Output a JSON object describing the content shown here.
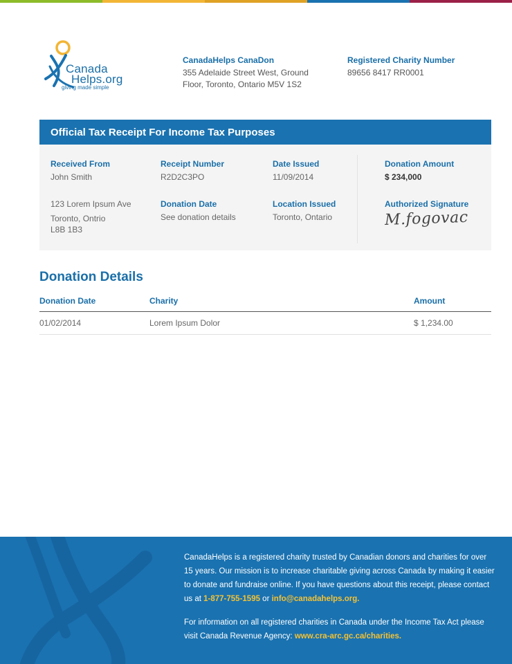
{
  "colors": {
    "primary": "#1a72b0",
    "accent": "#f5c233",
    "topbar": [
      "#8dbb2a",
      "#f2b535",
      "#e0a225",
      "#1a72b0",
      "#9b2148"
    ]
  },
  "logo": {
    "word1": "Canada",
    "word2": "Helps.org",
    "tagline": "giving made simple"
  },
  "header": {
    "org_name": "CanadaHelps CanaDon",
    "address_line1": "355 Adelaide Street West, Ground",
    "address_line2": "Floor, Toronto, Ontario M5V 1S2",
    "reg_label": "Registered Charity Number",
    "reg_number": "89656 8417 RR0001"
  },
  "receipt": {
    "title": "Official Tax Receipt For Income Tax Purposes",
    "received_from_label": "Received From",
    "received_from_name": "John Smith",
    "address_line1": "123 Lorem Ipsum Ave",
    "address_line2": "Toronto, Ontrio",
    "address_line3": "L8B 1B3",
    "receipt_number_label": "Receipt Number",
    "receipt_number": "R2D2C3PO",
    "donation_date_label": "Donation Date",
    "donation_date_value": "See donation details",
    "date_issued_label": "Date Issued",
    "date_issued": "11/09/2014",
    "location_label": "Location Issued",
    "location": "Toronto, Ontario",
    "amount_label": "Donation Amount",
    "amount": "$ 234,000",
    "signature_label": "Authorized Signature",
    "signature": "M.fogovac"
  },
  "details": {
    "title": "Donation Details",
    "columns": [
      "Donation Date",
      "Charity",
      "Amount"
    ],
    "rows": [
      [
        "01/02/2014",
        "Lorem Ipsum Dolor",
        "$ 1,234.00"
      ]
    ]
  },
  "footer": {
    "p1_text": "CanadaHelps is a registered charity trusted by Canadian donors and charities for over 15 years. Our mission is to increase charitable giving across Canada by making it easier to donate and fundraise online. If you have questions about this receipt, please contact us at ",
    "phone": "1-877-755-1595",
    "p1_or": " or ",
    "email": "info@canadahelps.org.",
    "p2_text": "For information on all registered charities in Canada under the Income Tax Act please visit Canada Revenue Agency: ",
    "link": "www.cra-arc.gc.ca/charities."
  }
}
